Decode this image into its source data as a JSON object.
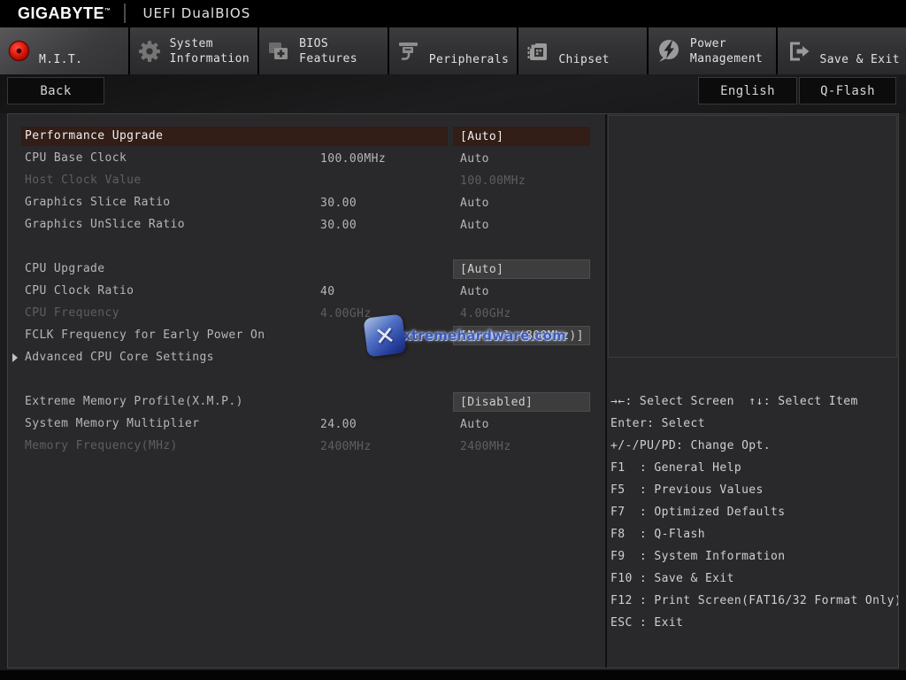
{
  "header": {
    "brand": "GIGABYTE",
    "brand_tm": "™",
    "title": "UEFI DualBIOS"
  },
  "tabs": {
    "items": [
      {
        "label": "M.I.T.",
        "icon": "record-dot-icon",
        "active": true
      },
      {
        "label": "System\nInformation",
        "icon": "gear-icon",
        "active": false
      },
      {
        "label": "BIOS\nFeatures",
        "icon": "folders-plus-icon",
        "active": false
      },
      {
        "label": "Peripherals",
        "icon": "peripheral-device-icon",
        "active": false
      },
      {
        "label": "Chipset",
        "icon": "chip-icon",
        "active": false
      },
      {
        "label": "Power\nManagement",
        "icon": "lightning-icon",
        "active": false
      },
      {
        "label": "Save & Exit",
        "icon": "exit-door-icon",
        "active": false
      }
    ]
  },
  "toolbar": {
    "back_label": "Back",
    "language_label": "English",
    "qflash_label": "Q-Flash"
  },
  "settings": {
    "rows": [
      {
        "label": "Performance Upgrade",
        "col2": "",
        "col3": "[Auto]",
        "state": "highlight",
        "boxed": true
      },
      {
        "label": "CPU Base Clock",
        "col2": "100.00MHz",
        "col3": "Auto",
        "state": "normal"
      },
      {
        "label": "Host Clock Value",
        "col2": "",
        "col3": "100.00MHz",
        "state": "dim"
      },
      {
        "label": "Graphics Slice Ratio",
        "col2": "30.00",
        "col3": "Auto",
        "state": "normal"
      },
      {
        "label": "Graphics UnSlice Ratio",
        "col2": "30.00",
        "col3": "Auto",
        "state": "normal"
      },
      {
        "type": "spacer"
      },
      {
        "label": "CPU Upgrade",
        "col2": "",
        "col3": "[Auto]",
        "state": "normal",
        "boxed": true
      },
      {
        "label": "CPU Clock Ratio",
        "col2": "40",
        "col3": "Auto",
        "state": "normal"
      },
      {
        "label": "CPU Frequency",
        "col2": "4.00GHz",
        "col3": "4.00GHz",
        "state": "dim"
      },
      {
        "label": "FCLK Frequency for Early Power On",
        "col2": "",
        "col3": "[Normal (800Mhz)]",
        "state": "normal",
        "boxed": true
      },
      {
        "label": "Advanced CPU Core Settings",
        "col2": "",
        "col3": "",
        "state": "normal",
        "arrow": true
      },
      {
        "type": "spacer"
      },
      {
        "label": "Extreme Memory Profile(X.M.P.)",
        "col2": "",
        "col3": "[Disabled]",
        "state": "normal",
        "boxed": true
      },
      {
        "label": "System Memory Multiplier",
        "col2": "24.00",
        "col3": "Auto",
        "state": "normal"
      },
      {
        "label": "Memory Frequency(MHz)",
        "col2": "2400MHz",
        "col3": "2400MHz",
        "state": "dim"
      }
    ]
  },
  "help": {
    "lines": [
      "→←: Select Screen  ↑↓: Select Item",
      "Enter: Select",
      "+/-/PU/PD: Change Opt.",
      "F1  : General Help",
      "F5  : Previous Values",
      "F7  : Optimized Defaults",
      "F8  : Q-Flash",
      "F9  : System Information",
      "F10 : Save & Exit",
      "F12 : Print Screen(FAT16/32 Format Only)",
      "ESC : Exit"
    ]
  },
  "watermark": {
    "x_glyph": "✕",
    "text": "xtremehardware.com"
  },
  "colors": {
    "highlight_bg": "#321d17",
    "value_box_bg": "#3d3d3d",
    "accent_red": "#e01408"
  }
}
